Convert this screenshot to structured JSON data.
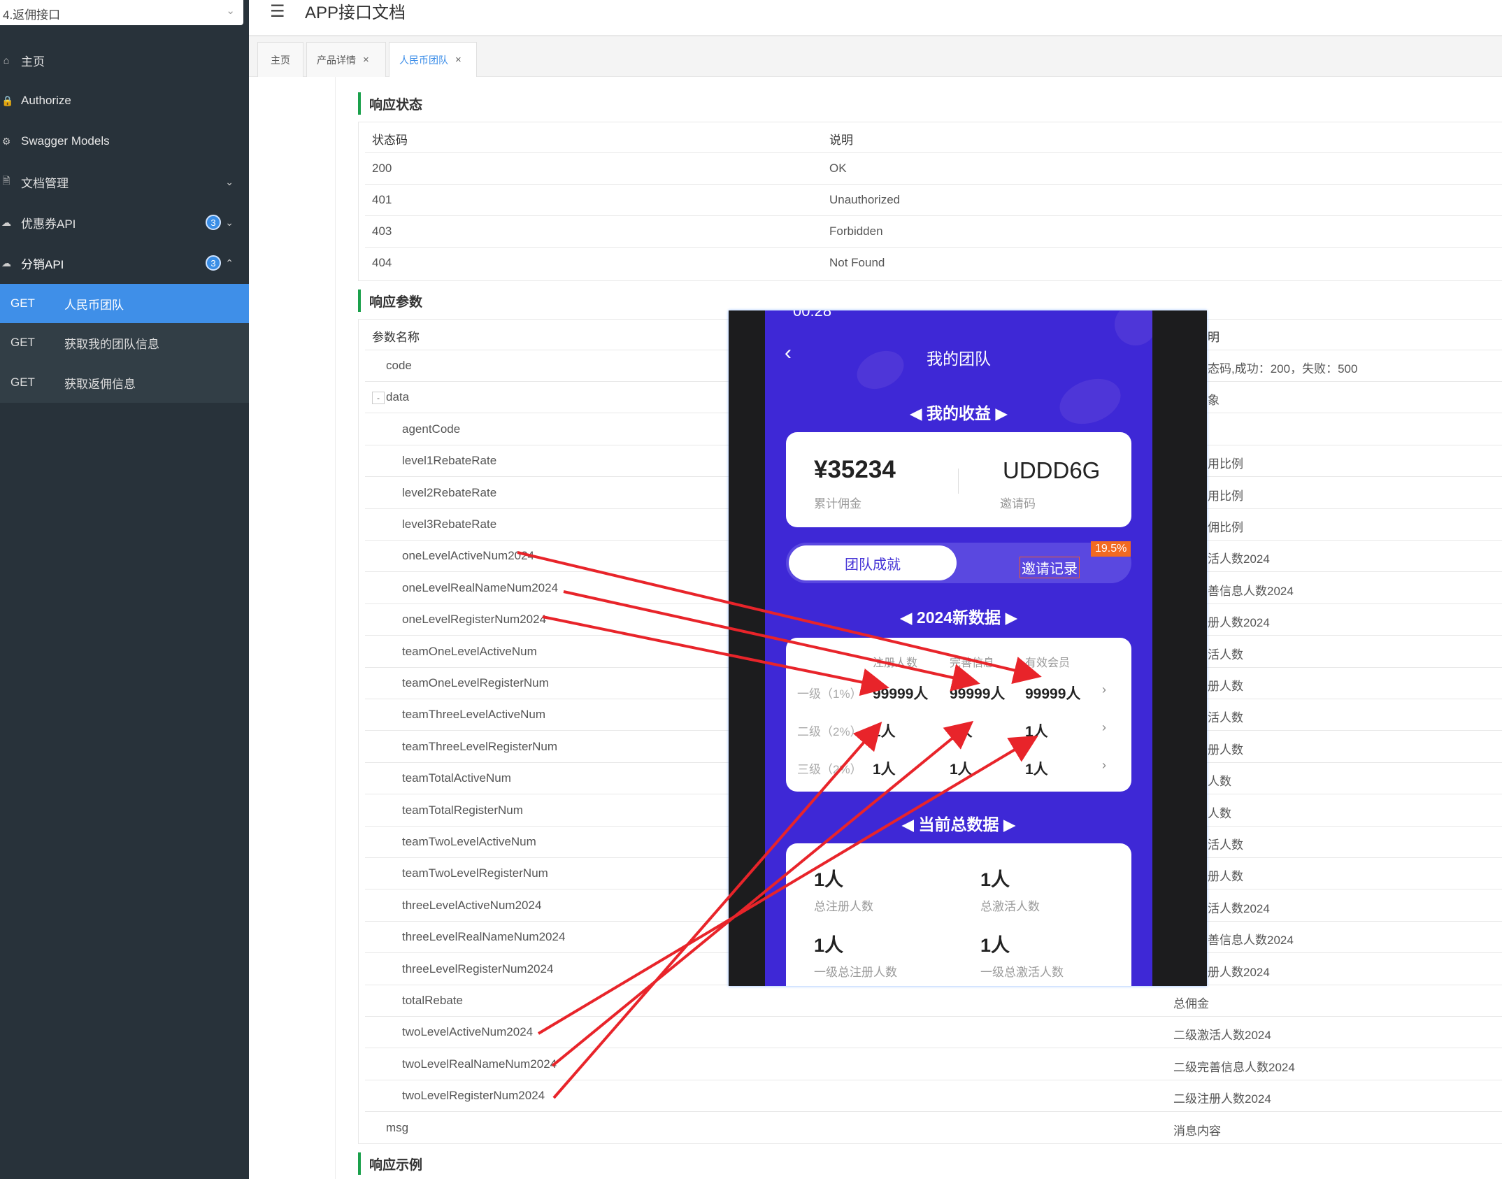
{
  "sidebar": {
    "project_select": "4.返佣接口",
    "menu": [
      {
        "icon": "home-icon",
        "glyph": "⌂",
        "label": "主页"
      },
      {
        "icon": "lock-icon",
        "glyph": "🔒",
        "label": "Authorize"
      },
      {
        "icon": "models-icon",
        "glyph": "⚙",
        "label": "Swagger Models"
      },
      {
        "icon": "doc-icon",
        "glyph": "🗎",
        "label": "文档管理"
      },
      {
        "icon": "cloud-icon",
        "glyph": "☁",
        "label": "优惠券API",
        "badge": "3"
      },
      {
        "icon": "cloud-icon",
        "glyph": "☁",
        "label": "分销API",
        "badge": "3"
      }
    ],
    "sub_items": [
      {
        "method": "GET",
        "label": "人民币团队"
      },
      {
        "method": "GET",
        "label": "获取我的团队信息"
      },
      {
        "method": "GET",
        "label": "获取返佣信息"
      }
    ]
  },
  "header": {
    "title": "APP接口文档"
  },
  "tabs": [
    {
      "label": "主页"
    },
    {
      "label": "产品详情"
    },
    {
      "label": "人民币团队"
    }
  ],
  "response_status": {
    "title": "响应状态",
    "headers": [
      "状态码",
      "说明"
    ],
    "rows": [
      [
        "200",
        "OK"
      ],
      [
        "401",
        "Unauthorized"
      ],
      [
        "403",
        "Forbidden"
      ],
      [
        "404",
        "Not Found"
      ]
    ]
  },
  "response_params": {
    "title": "响应参数",
    "headers": [
      "参数名称",
      "明"
    ],
    "rows": [
      [
        "code",
        "态码,成功：200，失败：500"
      ],
      [
        "data",
        "象"
      ],
      [
        "agentCode",
        ""
      ],
      [
        "level1RebateRate",
        "用比例"
      ],
      [
        "level2RebateRate",
        "用比例"
      ],
      [
        "level3RebateRate",
        "佣比例"
      ],
      [
        "oneLevelActiveNum2024",
        "活人数2024"
      ],
      [
        "oneLevelRealNameNum2024",
        "善信息人数2024"
      ],
      [
        "oneLevelRegisterNum2024",
        "册人数2024"
      ],
      [
        "teamOneLevelActiveNum",
        "活人数"
      ],
      [
        "teamOneLevelRegisterNum",
        "册人数"
      ],
      [
        "teamThreeLevelActiveNum",
        "活人数"
      ],
      [
        "teamThreeLevelRegisterNum",
        "册人数"
      ],
      [
        "teamTotalActiveNum",
        "人数"
      ],
      [
        "teamTotalRegisterNum",
        "人数"
      ],
      [
        "teamTwoLevelActiveNum",
        "活人数"
      ],
      [
        "teamTwoLevelRegisterNum",
        "册人数"
      ],
      [
        "threeLevelActiveNum2024",
        "活人数2024"
      ],
      [
        "threeLevelRealNameNum2024",
        "善信息人数2024"
      ],
      [
        "threeLevelRegisterNum2024",
        "册人数2024"
      ],
      [
        "totalRebate",
        "总佣金"
      ],
      [
        "twoLevelActiveNum2024",
        "二级激活人数2024"
      ],
      [
        "twoLevelRealNameNum2024",
        "二级完善信息人数2024"
      ],
      [
        "twoLevelRegisterNum2024",
        "二级注册人数2024"
      ],
      [
        "msg",
        "消息内容"
      ]
    ],
    "toggle": "-"
  },
  "response_example": {
    "title": "响应示例"
  },
  "phone": {
    "status_time": "00:28",
    "title": "我的团队",
    "earnings_section": "◀ 我的收益 ▶",
    "commission_value": "¥35234",
    "commission_label": "累计佣金",
    "invite_code_value": "UDDD6G",
    "invite_code_label": "邀请码",
    "tab_team": "团队成就",
    "tab_invite": "邀请记录",
    "percent_badge": "19.5%",
    "section_2024": "◀ 2024新数据 ▶",
    "grid_headers": [
      "注册人数",
      "完善信息",
      "有效会员"
    ],
    "grid_rows": [
      {
        "level": "一级（1%）",
        "values": [
          "99999人",
          "99999人",
          "99999人"
        ]
      },
      {
        "level": "二级（2%）",
        "values": [
          "1人",
          "1人",
          "1人"
        ]
      },
      {
        "level": "三级（2%）",
        "values": [
          "1人",
          "1人",
          "1人"
        ]
      }
    ],
    "section_total": "◀ 当前总数据 ▶",
    "totals": [
      {
        "value": "1人",
        "label": "总注册人数"
      },
      {
        "value": "1人",
        "label": "总激活人数"
      },
      {
        "value": "1人",
        "label": "一级总注册人数"
      },
      {
        "value": "1人",
        "label": "一级总激活人数"
      }
    ]
  },
  "colors": {
    "sidebar_bg": "#28323a",
    "active_blue": "#3f8fe8",
    "phone_purple": "#3e28d6",
    "arrow_red": "#e8242a",
    "section_green": "#1aa04b"
  }
}
